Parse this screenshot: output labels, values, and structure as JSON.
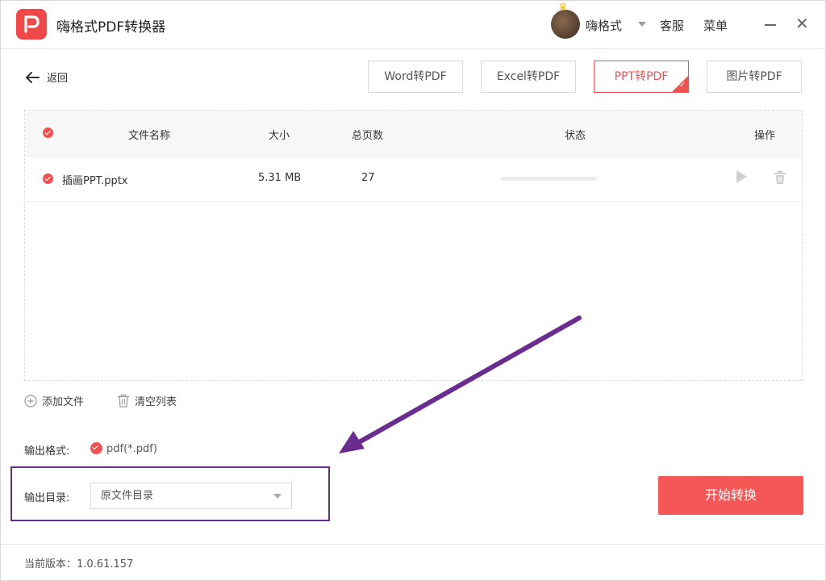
{
  "app": {
    "title": "嗨格式PDF转换器"
  },
  "header": {
    "user_name": "嗨格式",
    "service_label": "客服",
    "menu_label": "菜单"
  },
  "nav": {
    "back_label": "返回"
  },
  "tabs": [
    {
      "label": "Word转PDF",
      "active": false
    },
    {
      "label": "Excel转PDF",
      "active": false
    },
    {
      "label": "PPT转PDF",
      "active": true
    },
    {
      "label": "图片转PDF",
      "active": false
    }
  ],
  "table": {
    "columns": [
      "文件名称",
      "大小",
      "总页数",
      "状态",
      "操作"
    ],
    "rows": [
      {
        "name": "插画PPT.pptx",
        "size": "5.31 MB",
        "pages": "27",
        "progress": 0
      }
    ]
  },
  "actions": {
    "add_file": "添加文件",
    "clear_list": "清空列表"
  },
  "output": {
    "format_label": "输出格式:",
    "format_value": "pdf(*.pdf)",
    "directory_label": "输出目录:",
    "directory_value": "原文件目录"
  },
  "start_button": "开始转换",
  "footer": {
    "version": "当前版本：1.0.61.157"
  },
  "colors": {
    "accent": "#f05050",
    "annotation": "#6a2d8f"
  }
}
